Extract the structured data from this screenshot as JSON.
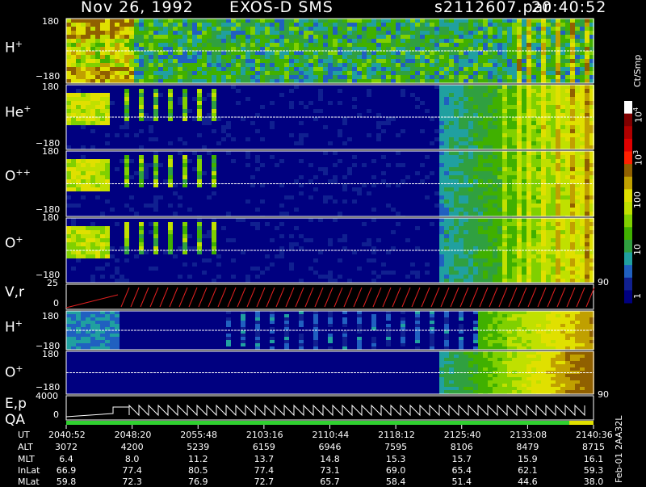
{
  "header": {
    "date": "Nov 26, 1992",
    "instrument": "EXOS-D SMS",
    "file": "s2112607.par",
    "time": "20:40:52"
  },
  "panels": [
    {
      "label": "H",
      "charge": "+",
      "ytop": "180",
      "ybot": "−180"
    },
    {
      "label": "He",
      "charge": "+",
      "ytop": "180",
      "ybot": "−180"
    },
    {
      "label": "O",
      "charge": "++",
      "ytop": "180",
      "ybot": "−180"
    },
    {
      "label": "O",
      "charge": "+",
      "ytop": "180",
      "ybot": "−180"
    },
    {
      "label": "V,r",
      "charge": "",
      "ytop": "25",
      "ybot": "0"
    },
    {
      "label": "H",
      "charge": "+",
      "ytop": "180",
      "ybot": "−180"
    },
    {
      "label": "O",
      "charge": "+",
      "ytop": "180",
      "ybot": "−180"
    },
    {
      "label": "E,p",
      "charge": "",
      "ytop": "4000",
      "ybot": "0"
    }
  ],
  "qa_label": "QA",
  "right_ticks": {
    "vr": "90",
    "ep": "90"
  },
  "colorbar": {
    "unit": "Ct/Smp",
    "labels": [
      "10^4",
      "10^3",
      "100",
      "10",
      "1"
    ],
    "colors": [
      "#ffffff",
      "#800000",
      "#b00000",
      "#e00000",
      "#ff2000",
      "#906000",
      "#c0a000",
      "#e0e000",
      "#c0e000",
      "#80d000",
      "#40b000",
      "#30a040",
      "#20a0a0",
      "#2060c0",
      "#102090",
      "#000080"
    ]
  },
  "chart_data": {
    "type": "heatmap",
    "time_axis": [
      "2040:52",
      "2048:20",
      "2055:48",
      "2103:16",
      "2110:44",
      "2118:12",
      "2125:40",
      "2133:08",
      "2140:36"
    ],
    "ephemeris": {
      "rows": [
        {
          "name": "UT",
          "values": [
            "2040:52",
            "2048:20",
            "2055:48",
            "2103:16",
            "2110:44",
            "2118:12",
            "2125:40",
            "2133:08",
            "2140:36"
          ]
        },
        {
          "name": "ALT",
          "values": [
            "3072",
            "4200",
            "5239",
            "6159",
            "6946",
            "7595",
            "8106",
            "8479",
            "8715"
          ]
        },
        {
          "name": "MLT",
          "values": [
            "6.4",
            "8.0",
            "11.2",
            "13.7",
            "14.8",
            "15.3",
            "15.7",
            "15.9",
            "16.1"
          ]
        },
        {
          "name": "InLat",
          "values": [
            "66.9",
            "77.4",
            "80.5",
            "77.4",
            "73.1",
            "69.0",
            "65.4",
            "62.1",
            "59.3"
          ]
        },
        {
          "name": "MLat",
          "values": [
            "59.8",
            "72.3",
            "76.9",
            "72.7",
            "65.7",
            "58.4",
            "51.4",
            "44.6",
            "38.0"
          ]
        }
      ]
    }
  },
  "side_note": "Feb-01 2AA32L"
}
